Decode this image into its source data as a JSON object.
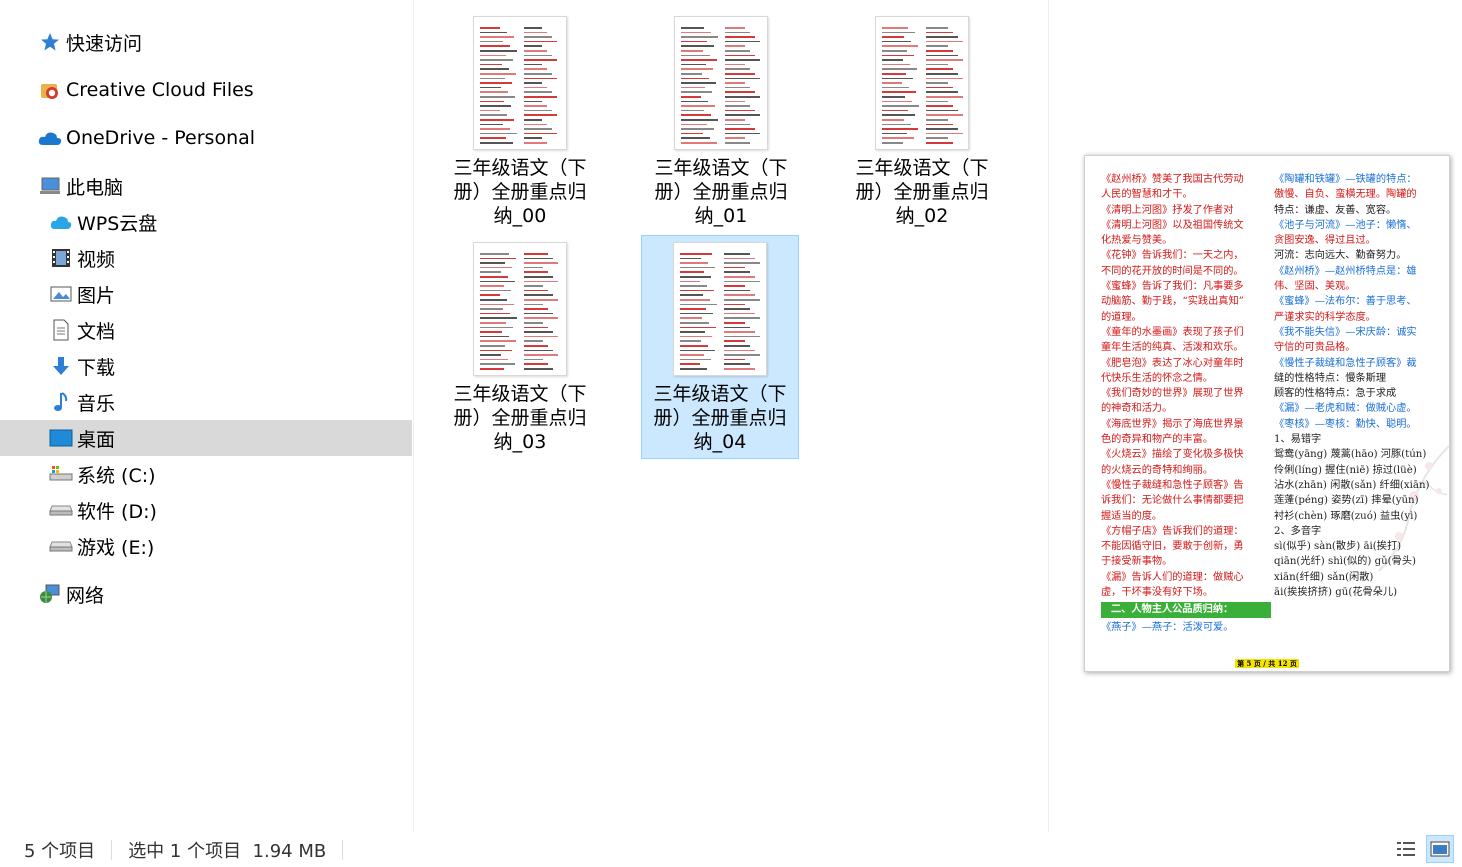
{
  "sidebar": {
    "items": [
      {
        "label": "快速访问",
        "icon": "star-icon",
        "level": 1
      },
      {
        "label": "Creative Cloud Files",
        "icon": "creative-cloud-icon",
        "level": 1
      },
      {
        "label": "OneDrive - Personal",
        "icon": "onedrive-cloud-icon",
        "level": 1
      },
      {
        "label": "此电脑",
        "icon": "computer-icon",
        "level": 1
      },
      {
        "label": "WPS云盘",
        "icon": "wps-cloud-icon",
        "level": 2
      },
      {
        "label": "视频",
        "icon": "video-icon",
        "level": 2
      },
      {
        "label": "图片",
        "icon": "pictures-icon",
        "level": 2
      },
      {
        "label": "文档",
        "icon": "documents-icon",
        "level": 2
      },
      {
        "label": "下载",
        "icon": "download-icon",
        "level": 2
      },
      {
        "label": "音乐",
        "icon": "music-icon",
        "level": 2
      },
      {
        "label": "桌面",
        "icon": "desktop-icon",
        "level": 2,
        "selected": true
      },
      {
        "label": "系统 (C:)",
        "icon": "system-drive-icon",
        "level": 2
      },
      {
        "label": "软件 (D:)",
        "icon": "drive-icon",
        "level": 2
      },
      {
        "label": "游戏 (E:)",
        "icon": "drive-icon",
        "level": 2
      },
      {
        "label": "网络",
        "icon": "network-icon",
        "level": 1
      }
    ]
  },
  "files": [
    {
      "name": "三年级语文（下册）全册重点归纳_00",
      "selected": false
    },
    {
      "name": "三年级语文（下册）全册重点归纳_01",
      "selected": false
    },
    {
      "name": "三年级语文（下册）全册重点归纳_02",
      "selected": false
    },
    {
      "name": "三年级语文（下册）全册重点归纳_03",
      "selected": false
    },
    {
      "name": "三年级语文（下册）全册重点归纳_04",
      "selected": true
    }
  ],
  "preview": {
    "left_lines": [
      {
        "t": "《赵州桥》赞美了我国古代劳动",
        "c": "red"
      },
      {
        "t": "人民的智慧和才干。",
        "c": "red"
      },
      {
        "t": "《清明上河图》抒发了作者对",
        "c": "red"
      },
      {
        "t": "《清明上河图》以及祖国传统文",
        "c": "red"
      },
      {
        "t": "化热爱与赞美。",
        "c": "red"
      },
      {
        "t": "《花钟》告诉我们：一天之内，",
        "c": "red"
      },
      {
        "t": "不同的花开放的时间是不同的。",
        "c": "red"
      },
      {
        "t": "《蜜蜂》告诉了我们：凡事要多",
        "c": "red"
      },
      {
        "t": "动脑筋、勤于践，“实践出真知”",
        "c": "red"
      },
      {
        "t": "的道理。",
        "c": "red"
      },
      {
        "t": "《童年的水墨画》表现了孩子们",
        "c": "red"
      },
      {
        "t": "童年生活的纯真、活泼和欢乐。",
        "c": "red"
      },
      {
        "t": "《肥皂泡》表达了冰心对童年时",
        "c": "red"
      },
      {
        "t": "代快乐生活的怀念之情。",
        "c": "red"
      },
      {
        "t": "《我们奇妙的世界》展现了世界",
        "c": "red"
      },
      {
        "t": "的神奇和活力。",
        "c": "red"
      },
      {
        "t": "《海底世界》揭示了海底世界景",
        "c": "red"
      },
      {
        "t": "色的奇异和物产的丰富。",
        "c": "red"
      },
      {
        "t": "《火烧云》描绘了变化极多极快",
        "c": "red"
      },
      {
        "t": "的火烧云的奇特和绚丽。",
        "c": "red"
      },
      {
        "t": "《慢性子裁缝和急性子顾客》告",
        "c": "red"
      },
      {
        "t": "诉我们：无论做什么事情都要把",
        "c": "red"
      },
      {
        "t": "握适当的度。",
        "c": "red"
      },
      {
        "t": "《方帽子店》告诉我们的道理：",
        "c": "red"
      },
      {
        "t": "不能因循守旧，要敢于创新，勇",
        "c": "red"
      },
      {
        "t": "于接受新事物。",
        "c": "red"
      },
      {
        "t": "《漏》告诉人们的道理：做贼心",
        "c": "red"
      },
      {
        "t": "虚，干坏事没有好下场。",
        "c": "red"
      },
      {
        "t": "二、人物主人公品质归纳：",
        "c": "green"
      },
      {
        "t": "《燕子》—燕子：活泼可爱。",
        "c": "blue"
      }
    ],
    "right_lines": [
      {
        "t": "《陶罐和铁罐》—铁罐的特点：",
        "c": "blue"
      },
      {
        "t": "傲慢、自负、蛮横无理。陶罐的",
        "c": "red"
      },
      {
        "t": "特点：谦虚、友善、宽容。",
        "c": "blk"
      },
      {
        "t": "《池子与河流》—池子：懒惰、",
        "c": "blue"
      },
      {
        "t": "贪图安逸、得过且过。",
        "c": "red"
      },
      {
        "t": "河流：志向远大、勤奋努力。",
        "c": "blk"
      },
      {
        "t": "《赵州桥》—赵州桥特点是：雄",
        "c": "blue"
      },
      {
        "t": "伟、坚固、美观。",
        "c": "red"
      },
      {
        "t": "《蜜蜂》—法布尔：善于思考、",
        "c": "blue"
      },
      {
        "t": "严谨求实的科学态度。",
        "c": "red"
      },
      {
        "t": "《我不能失信》—宋庆龄：诚实",
        "c": "blue"
      },
      {
        "t": "守信的可贵品格。",
        "c": "red"
      },
      {
        "t": "《慢性子裁缝和急性子顾客》裁",
        "c": "blue"
      },
      {
        "t": "缝的性格特点：慢条斯理",
        "c": "blk"
      },
      {
        "t": "顾客的性格特点：急于求成",
        "c": "blk"
      },
      {
        "t": "《漏》—老虎和贼：做贼心虚。",
        "c": "blue"
      },
      {
        "t": "《枣核》—枣核：勤快、聪明。",
        "c": "blue"
      },
      {
        "t": "1、易错字",
        "c": "blk"
      },
      {
        "t": "鸳鸯(yāng) 蔑蒿(hāo) 河豚(tún)",
        "c": "blk"
      },
      {
        "t": "伶俐(líng) 握住(niē) 掠过(lüè)",
        "c": "blk"
      },
      {
        "t": "沾水(zhān) 闲散(sǎn) 纤细(xiān)",
        "c": "blk"
      },
      {
        "t": "莲蓬(péng) 姿势(zī) 摔晕(yūn)",
        "c": "blk"
      },
      {
        "t": "衬衫(chèn) 琢磨(zuó) 益虫(yì)",
        "c": "blk"
      },
      {
        "t": "2、多音字",
        "c": "blk"
      },
      {
        "t": "sì(似乎)   sàn(散步)   āi(挨打)",
        "c": "blk"
      },
      {
        "t": "qiān(光纤) shì(似的)  gǔ(骨头)",
        "c": "blk"
      },
      {
        "t": "xiān(纤细) sǎn(闲散)",
        "c": "blk"
      },
      {
        "t": "āi(挨挨挤挤) gū(花骨朵儿)",
        "c": "blk"
      }
    ],
    "footer": "第 5 页 / 共 12 页"
  },
  "status": {
    "item_count": "5 个项目",
    "selection": "选中 1 个项目  1.94 MB"
  },
  "colors": {
    "selection_bg": "#cce8ff",
    "selection_border": "#99d1ff",
    "sidebar_selected": "#d9d9d9",
    "doc_red": "#d41818",
    "doc_blue": "#1a6fd6"
  }
}
